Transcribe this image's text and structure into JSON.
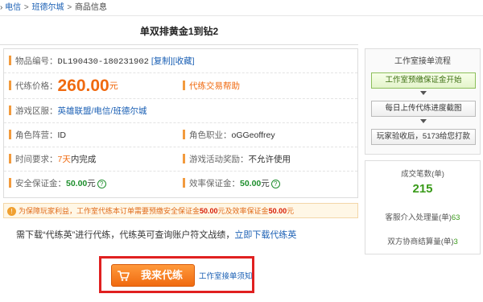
{
  "breadcrumb": {
    "prefix": "›",
    "items": [
      "电信",
      "班德尔城",
      "商品信息"
    ],
    "separator": ">"
  },
  "title": "单双排黄金1到钻2",
  "info": {
    "order_no_label": "物品编号：",
    "order_no_value": "DL190430-180231902",
    "copy_link": "[复制]",
    "fav_link": "[收藏]",
    "price_label": "代练价格：",
    "price_value": "260.00",
    "price_unit": "元",
    "trade_help": "代练交易帮助",
    "server_label": "游戏区服：",
    "server_value": "英雄联盟/电信/班德尔城",
    "camp_label": "角色阵营：",
    "camp_value": "ID",
    "job_label": "角色职业：",
    "job_value": "oGGeoffrey",
    "time_label": "时间要求：",
    "time_days": "7天",
    "time_suffix": "内完成",
    "reward_label": "游戏活动奖励：",
    "reward_value": "不允许使用",
    "safe_deposit_label": "安全保证金：",
    "safe_deposit_value": "50.00",
    "safe_deposit_unit": "元",
    "eff_deposit_label": "效率保证金：",
    "eff_deposit_value": "50.00",
    "eff_deposit_unit": "元",
    "help_glyph": "?"
  },
  "notice": {
    "icon": "!",
    "text_a": "为保障玩家利益，工作室代练本订单需要预缴安全保证金",
    "amount_a": "50.00",
    "text_b": "元及效率保证金",
    "amount_b": "50.00",
    "text_c": "元"
  },
  "download": {
    "text": "需下载“代练英”进行代练，代练英可查询账户符文战绩，",
    "link": "立即下载代练英"
  },
  "cta": {
    "button_label": "我来代练",
    "link_label": "工作室接单须知"
  },
  "sidebar": {
    "title": "工作室接单流程",
    "steps": [
      "工作室预缴保证金开始",
      "每日上传代练进度截图",
      "玩家验收后，5173给您打款"
    ]
  },
  "stats": {
    "deals_label": "成交笔数(单)",
    "deals_value": "215",
    "service_label": "客服介入处理量(单)",
    "service_value": "63",
    "negotiate_label": "双方协商结算量(单)",
    "negotiate_value": "3"
  },
  "colors": {
    "accent_orange": "#f06a10",
    "link_blue": "#1a5fb4",
    "green": "#1d8e2c",
    "highlight_red": "#e02020"
  }
}
